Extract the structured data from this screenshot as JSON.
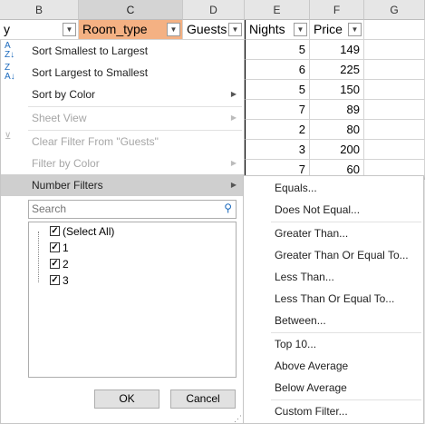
{
  "columns": [
    "B",
    "C",
    "D",
    "E",
    "F",
    "G"
  ],
  "table_header": {
    "col_b": "y",
    "room_type": "Room_type",
    "guests": "Guests",
    "nights": "Nights",
    "price": "Price"
  },
  "rows": [
    {
      "nights": "5",
      "price": "149"
    },
    {
      "nights": "6",
      "price": "225"
    },
    {
      "nights": "5",
      "price": "150"
    },
    {
      "nights": "7",
      "price": "89"
    },
    {
      "nights": "2",
      "price": "80"
    },
    {
      "nights": "3",
      "price": "200"
    },
    {
      "nights": "7",
      "price": "60"
    }
  ],
  "menu": {
    "sort_smallest": "Sort Smallest to Largest",
    "sort_largest": "Sort Largest to Smallest",
    "sort_by_color": "Sort by Color",
    "sheet_view": "Sheet View",
    "clear_filter": "Clear Filter From \"Guests\"",
    "filter_by_color": "Filter by Color",
    "number_filters": "Number Filters",
    "search_placeholder": "Search",
    "list_items": [
      "(Select All)",
      "1",
      "2",
      "3"
    ],
    "ok": "OK",
    "cancel": "Cancel"
  },
  "submenu": {
    "equals": "Equals...",
    "not_equal": "Does Not Equal...",
    "greater": "Greater Than...",
    "greater_equal": "Greater Than Or Equal To...",
    "less": "Less Than...",
    "less_equal": "Less Than Or Equal To...",
    "between": "Between...",
    "top10": "Top 10...",
    "above_avg": "Above Average",
    "below_avg": "Below Average",
    "custom": "Custom Filter..."
  }
}
